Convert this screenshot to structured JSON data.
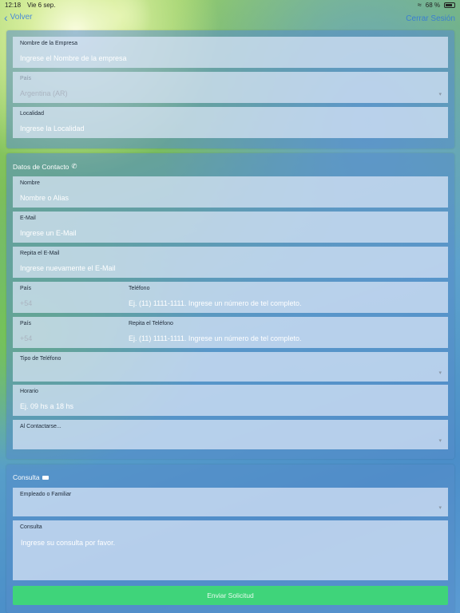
{
  "status_bar": {
    "time": "12:18",
    "date": "Vie 6 sep.",
    "battery": "68 %"
  },
  "nav": {
    "back_label": "Volver",
    "logout_label": "Cerrar Sesión"
  },
  "company": {
    "name_label": "Nombre de la Empresa",
    "name_placeholder": "Ingrese el Nombre de la empresa",
    "country_label": "País",
    "country_value": "Argentina (AR)",
    "locality_label": "Localidad",
    "locality_placeholder": "Ingrese la Localidad"
  },
  "contact": {
    "title": "Datos de Contacto",
    "name_label": "Nombre",
    "name_placeholder": "Nombre o Alias",
    "email_label": "E-Mail",
    "email_placeholder": "Ingrese un E-Mail",
    "email_repeat_label": "Repita el E-Mail",
    "email_repeat_placeholder": "Ingrese nuevamente el E-Mail",
    "country_code_label": "País",
    "country_code_value": "+54",
    "phone_label": "Teléfono",
    "phone_placeholder": "Ej. (11) 1111-1111. Ingrese un número de tel completo.",
    "country_code_label_2": "País",
    "country_code_value_2": "+54",
    "phone_repeat_label": "Repita el Teléfono",
    "phone_repeat_placeholder": "Ej. (11) 1111-1111. Ingrese un número de tel completo.",
    "phone_type_label": "Tipo de Teléfono",
    "schedule_label": "Horario",
    "schedule_placeholder": "Ej. 09 hs a 18 hs",
    "on_contact_label": "Al Contactarse..."
  },
  "query": {
    "title": "Consulta",
    "employee_label": "Empleado o Familiar",
    "query_label": "Consulta",
    "query_placeholder": "Ingrese su consulta por favor.",
    "submit_label": "Enviar Solicitud"
  }
}
